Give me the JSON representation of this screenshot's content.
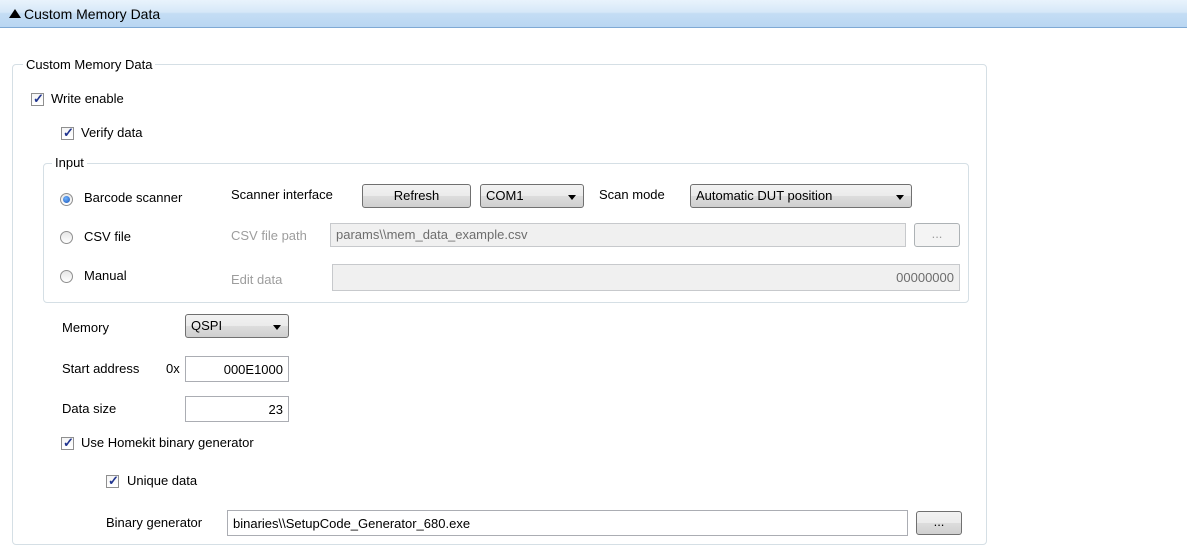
{
  "header": {
    "title": "Custom Memory Data"
  },
  "group": {
    "legend": "Custom Memory Data"
  },
  "write_enable": {
    "label": "Write enable",
    "checked": true
  },
  "verify_data": {
    "label": "Verify data",
    "checked": true
  },
  "input": {
    "legend": "Input",
    "barcode": {
      "label": "Barcode scanner",
      "selected": true
    },
    "scanner_interface_label": "Scanner interface",
    "refresh_label": "Refresh",
    "com_port": "COM1",
    "scan_mode_label": "Scan mode",
    "scan_mode_value": "Automatic DUT position",
    "csv": {
      "label": "CSV file",
      "selected": false
    },
    "csv_path_label": "CSV file path",
    "csv_path_value": "params\\\\mem_data_example.csv",
    "browse_label": "...",
    "manual": {
      "label": "Manual",
      "selected": false
    },
    "edit_data_label": "Edit data",
    "edit_data_value": "00000000"
  },
  "memory": {
    "label": "Memory",
    "value": "QSPI"
  },
  "start_address": {
    "label": "Start address",
    "prefix": "0x",
    "value": "000E1000"
  },
  "data_size": {
    "label": "Data size",
    "value": "23"
  },
  "homekit": {
    "label": "Use Homekit binary generator",
    "checked": true
  },
  "unique": {
    "label": "Unique data",
    "checked": true
  },
  "binary_generator": {
    "label": "Binary generator",
    "value": "binaries\\\\SetupCode_Generator_680.exe",
    "browse_label": "..."
  }
}
